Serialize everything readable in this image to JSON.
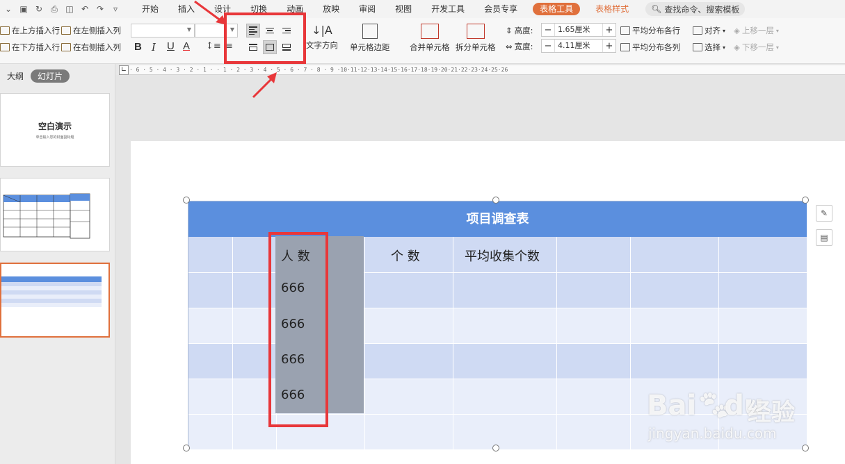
{
  "menu": {
    "items": [
      "开始",
      "插入",
      "设计",
      "切换",
      "动画",
      "放映",
      "审阅",
      "视图",
      "开发工具",
      "会员专享"
    ],
    "table_tools": "表格工具",
    "table_style": "表格样式",
    "search": "查找命令、搜索模板"
  },
  "ribbon": {
    "insert_above": "在上方插入行",
    "insert_below": "在下方插入行",
    "insert_left": "在左侧插入列",
    "insert_right": "在右侧插入列",
    "text_direction": "文字方向",
    "cell_margin": "单元格边距",
    "merge": "合并单元格",
    "split": "拆分单元格",
    "height_label": "高度:",
    "height_value": "1.65厘米",
    "width_label": "宽度:",
    "width_value": "4.11厘米",
    "dist_rows": "平均分布各行",
    "dist_cols": "平均分布各列",
    "align": "对齐",
    "select": "选择",
    "bring_forward": "上移一层",
    "send_backward": "下移一层",
    "bold": "B",
    "italic": "I",
    "underline": "U",
    "font_color": "A"
  },
  "ruler": {
    "numbers": "· 6 · 5 · 4 · 3 · 2 · 1 · · 1 · 2 · 3 · 4 · 5 · 6 · 7 · 8 · 9 ·10·11·12·13·14·15·16·17·18·19·20·21·22·23·24·25·26"
  },
  "left_panel": {
    "tab_outline": "大纲",
    "tab_slides": "幻灯片",
    "thumb1_title": "空白演示",
    "thumb1_sub": "单击输入您的封面副标题"
  },
  "table": {
    "title": "项目调查表",
    "headers": [
      "人  数",
      "个  数",
      "平均收集个数"
    ],
    "values": [
      "666",
      "666",
      "666",
      "666"
    ]
  },
  "watermark": {
    "brand": "Bai",
    "brand2": "du",
    "cn": "经验",
    "url": "jingyan.baidu.com"
  }
}
